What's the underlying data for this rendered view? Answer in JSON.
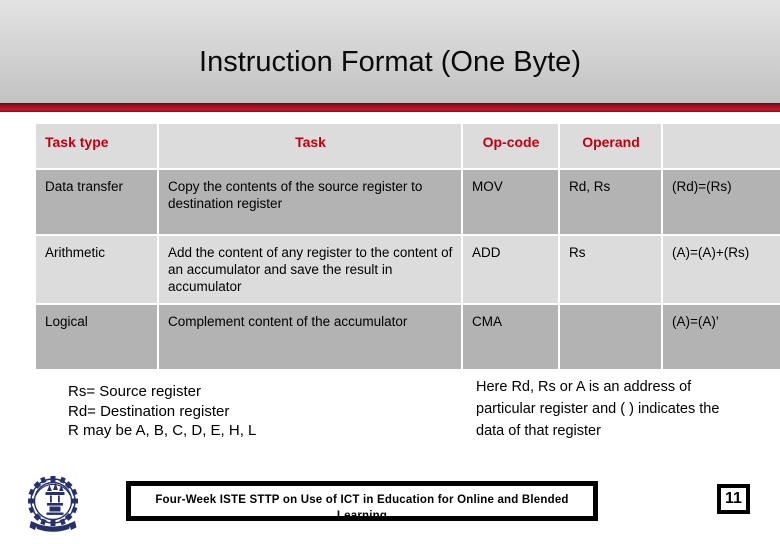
{
  "slide": {
    "title": "Instruction Format (One Byte)",
    "accent_color": "#c00010",
    "rule_color": "#b4111f",
    "header_bg": "#d6d6d6"
  },
  "table": {
    "columns": [
      "Task type",
      "Task",
      "Op-code",
      "Operand",
      ""
    ],
    "rows": [
      {
        "task_type": "Data transfer",
        "task": "Copy the contents of the source register to destination register",
        "opcode": "MOV",
        "operand": "Rd, Rs",
        "result": "(Rd)=(Rs)"
      },
      {
        "task_type": "Arithmetic",
        "task": "Add the content of any register to the content of an accumulator and save the result in accumulator",
        "opcode": "ADD",
        "operand": "Rs",
        "result": "(A)=(A)+(Rs)"
      },
      {
        "task_type": "Logical",
        "task": "Complement content of the accumulator",
        "opcode": "CMA",
        "operand": "",
        "result": "(A)=(A)’"
      }
    ]
  },
  "notes": {
    "left": "Rs= Source register\nRd= Destination register\nR may be A, B, C, D, E, H, L",
    "right": "Here Rd, Rs or A is an address of particular register and (  ) indicates the data of that register"
  },
  "footer": {
    "banner_text": "Four-Week ISTE STTP on Use of ICT in Education for Online and Blended Learning",
    "page_number": "11",
    "logo_name": "iitb-gear-emblem"
  }
}
